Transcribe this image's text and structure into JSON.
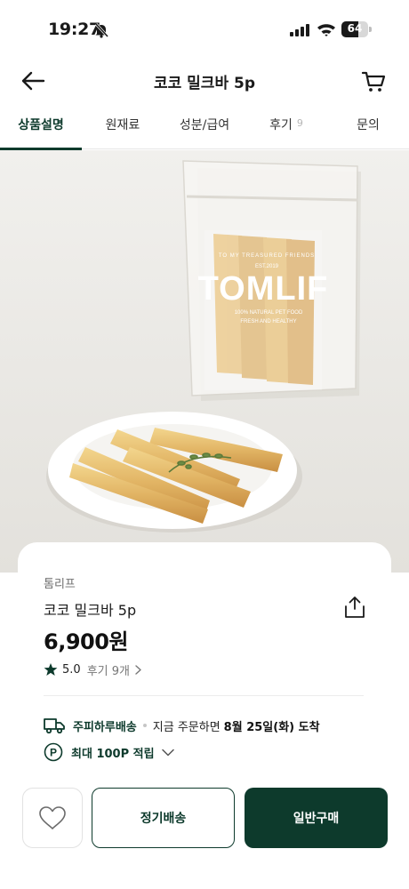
{
  "status_bar": {
    "time": "19:27",
    "battery_level": "64",
    "icons": [
      "bell-slash-icon",
      "cellular-signal-icon",
      "wifi-icon",
      "battery-icon"
    ]
  },
  "header": {
    "title": "코코 밀크바 5p",
    "icons": [
      "arrow-left-icon",
      "cart-icon"
    ]
  },
  "tabs": [
    {
      "label": "상품설명",
      "active": true
    },
    {
      "label": "원재료",
      "active": false
    },
    {
      "label": "성분/급여",
      "active": false
    },
    {
      "label": "후기",
      "count": "9",
      "active": false
    },
    {
      "label": "문의",
      "active": false
    }
  ],
  "product_image": {
    "package_brand": "TOMLIF",
    "package_ring_text": "TO MY TREASURED FRIENDS",
    "package_est": "EST.2019",
    "package_tagline_1": "100% NATURAL PET FOOD",
    "package_tagline_2": "FRESH AND HEALTHY"
  },
  "product": {
    "brand": "톰리프",
    "name": "코코 밀크바 5p",
    "price": "6,900원",
    "rating": "5.0",
    "review_label": "후기 9개",
    "delivery": {
      "name": "주피하루배송",
      "text": "지금 주문하면",
      "date": "8월 25일(화) 도착"
    },
    "points": {
      "badge": "P",
      "text": "최대 100P 적립"
    },
    "icons": [
      "share-icon",
      "star-icon",
      "truck-icon",
      "chevron-down-icon",
      "chevron-right-icon"
    ]
  },
  "bottom_bar": {
    "subscription_label": "정기배송",
    "buy_label": "일반구매",
    "icons": [
      "heart-icon"
    ]
  },
  "colors": {
    "primary": "#0d3a2c",
    "background": "#ffffff",
    "muted_text": "#777777"
  }
}
